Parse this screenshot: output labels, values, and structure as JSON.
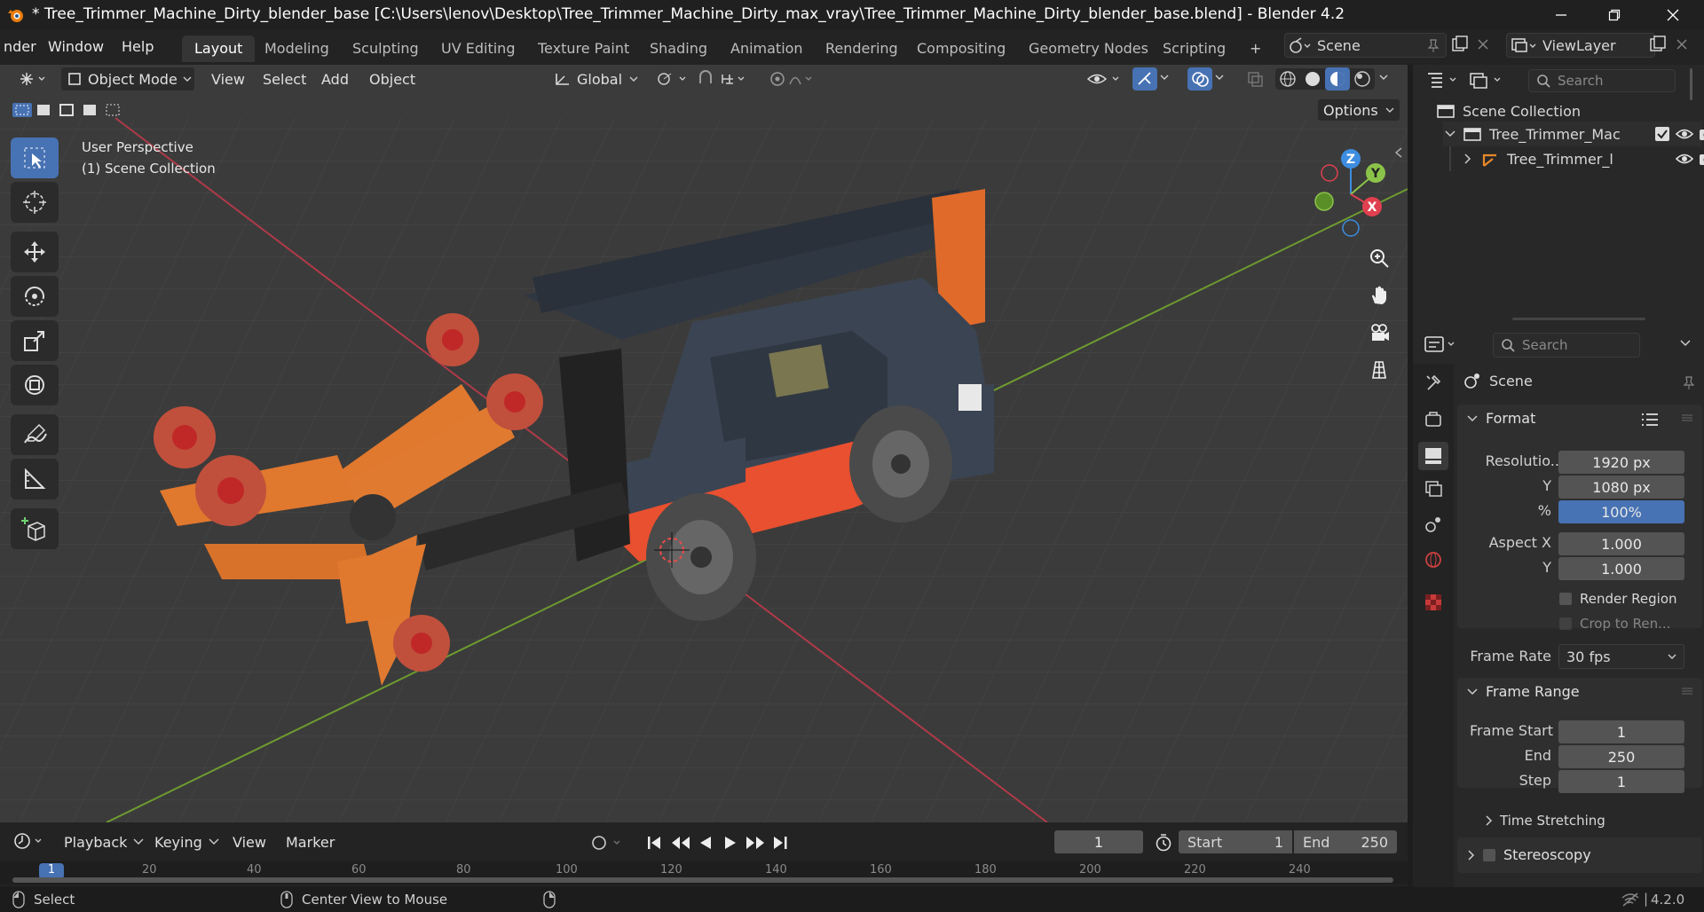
{
  "title_bar": {
    "title": "* Tree_Trimmer_Machine_Dirty_blender_base [C:\\Users\\lenov\\Desktop\\Tree_Trimmer_Machine_Dirty_max_vray\\Tree_Trimmer_Machine_Dirty_blender_base.blend] - Blender 4.2"
  },
  "menu": {
    "items": [
      "nder",
      "Window",
      "Help"
    ]
  },
  "workspaces": {
    "tabs": [
      "Layout",
      "Modeling",
      "Sculpting",
      "UV Editing",
      "Texture Paint",
      "Shading",
      "Animation",
      "Rendering",
      "Compositing",
      "Geometry Nodes",
      "Scripting"
    ],
    "active": "Layout",
    "add_label": "+"
  },
  "scene_selector": {
    "value": "Scene"
  },
  "viewlayer_selector": {
    "value": "ViewLayer"
  },
  "viewport_header": {
    "mode": "Object Mode",
    "menus": [
      "View",
      "Select",
      "Add",
      "Object"
    ],
    "transform_orientation": "Global",
    "options_label": "Options"
  },
  "viewport": {
    "perspective_label": "User Perspective",
    "collection_label": "(1) Scene Collection",
    "gizmo_axes": [
      "Z",
      "Y",
      "X"
    ]
  },
  "outliner": {
    "search_placeholder": "Search",
    "root": "Scene Collection",
    "items": [
      {
        "label": "Tree_Trimmer_Mac"
      },
      {
        "label": "Tree_Trimmer_l"
      }
    ]
  },
  "properties": {
    "search_placeholder": "Search",
    "context": "Scene",
    "format_section": "Format",
    "resolution_label": "Resolutio...",
    "resolution_x": "1920 px",
    "y_label": "Y",
    "resolution_y": "1080 px",
    "percent_label": "%",
    "resolution_percent": "100%",
    "aspect_x_label": "Aspect X",
    "aspect_x": "1.000",
    "aspect_y_label": "Y",
    "aspect_y": "1.000",
    "render_region": "Render Region",
    "crop_to_render": "Crop to Ren...",
    "frame_rate_label": "Frame Rate",
    "frame_rate": "30 fps",
    "frame_range_section": "Frame Range",
    "frame_start_label": "Frame Start",
    "frame_start": "1",
    "end_label": "End",
    "frame_end": "250",
    "step_label": "Step",
    "frame_step": "1",
    "time_stretching": "Time Stretching",
    "stereoscopy": "Stereoscopy"
  },
  "timeline": {
    "menus": [
      "Playback",
      "Keying",
      "View",
      "Marker"
    ],
    "current_frame": "1",
    "start_label": "Start",
    "start_value": "1",
    "end_label": "End",
    "end_value": "250",
    "ruler": [
      "20",
      "40",
      "60",
      "80",
      "100",
      "120",
      "140",
      "160",
      "180",
      "200",
      "220",
      "240"
    ],
    "playhead": "1"
  },
  "status_bar": {
    "select": "Select",
    "center_view": "Center View to Mouse",
    "version": "4.2.0"
  },
  "colors": {
    "accent": "#4772b3",
    "axis_x": "#e0404f",
    "axis_y": "#8bc34a",
    "axis_z": "#3d8de0",
    "vehicle_orange": "#e06a2a"
  }
}
